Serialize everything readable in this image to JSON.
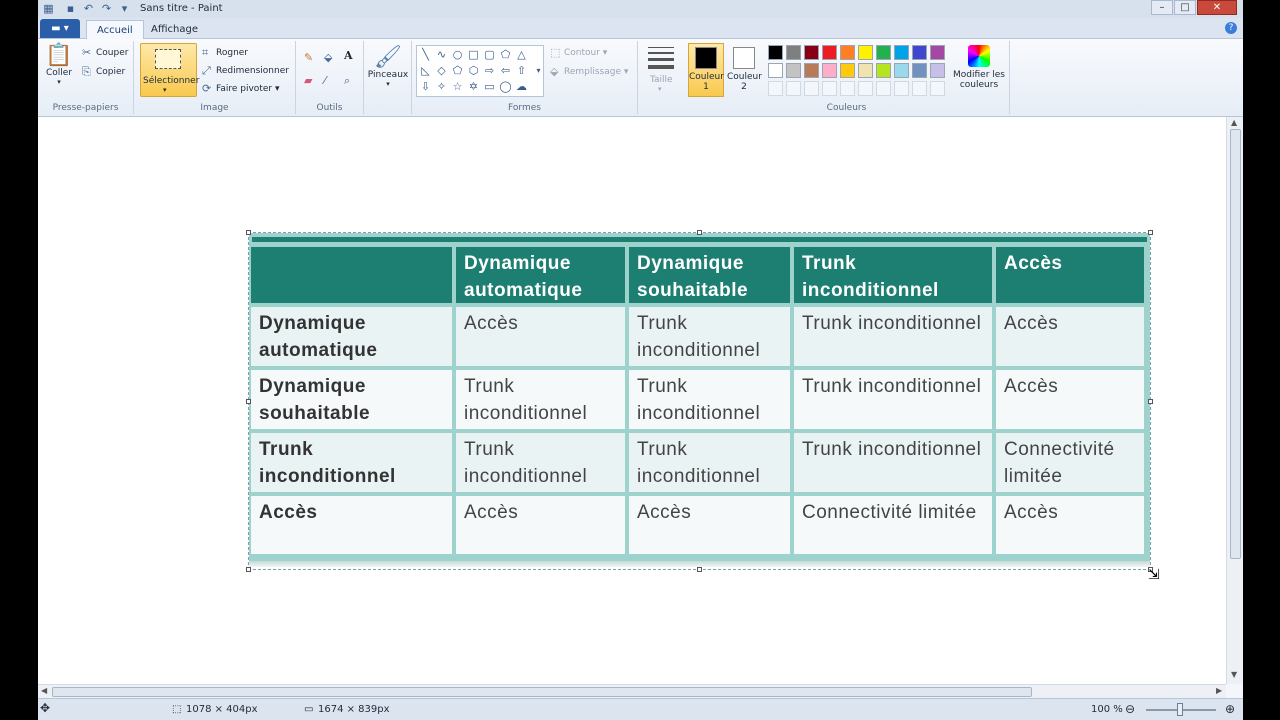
{
  "window": {
    "title": "Sans titre - Paint",
    "controls": {
      "minimize": "–",
      "maximize": "□",
      "close": "✕"
    }
  },
  "tabs": {
    "file_menu": "▾",
    "home": "Accueil",
    "view": "Affichage"
  },
  "ribbon": {
    "clipboard": {
      "label": "Presse-papiers",
      "paste": "Coller",
      "cut": "Couper",
      "copy": "Copier"
    },
    "image": {
      "label": "Image",
      "select": "Sélectionner",
      "crop": "Rogner",
      "resize": "Redimensionner",
      "rotate": "Faire pivoter"
    },
    "tools": {
      "label": "Outils"
    },
    "brushes": {
      "label": "Pinceaux"
    },
    "shapes": {
      "label": "Formes",
      "outline": "Contour",
      "fill": "Remplissage"
    },
    "size": {
      "label": "Taille"
    },
    "colors": {
      "label": "Couleurs",
      "color1": "Couleur 1",
      "color2": "Couleur 2",
      "edit": "Modifier les couleurs",
      "color1_value": "#000000",
      "color2_value": "#ffffff",
      "palette_row1": [
        "#000000",
        "#7f7f7f",
        "#880015",
        "#ed1c24",
        "#ff7f27",
        "#fff200",
        "#22b14c",
        "#00a2e8",
        "#3f48cc",
        "#a349a4"
      ],
      "palette_row2": [
        "#ffffff",
        "#c3c3c3",
        "#b97a57",
        "#ffaec9",
        "#ffc90e",
        "#efe4b0",
        "#b5e61d",
        "#99d9ea",
        "#7092be",
        "#c8bfe7"
      ]
    }
  },
  "table": {
    "headers": [
      "",
      "Dynamique automatique",
      "Dynamique souhaitable",
      "Trunk inconditionnel",
      "Accès"
    ],
    "rows": [
      [
        "Dynamique automatique",
        "Accès",
        "Trunk inconditionnel",
        "Trunk inconditionnel",
        "Accès"
      ],
      [
        "Dynamique souhaitable",
        "Trunk inconditionnel",
        "Trunk inconditionnel",
        "Trunk inconditionnel",
        "Accès"
      ],
      [
        "Trunk inconditionnel",
        "Trunk inconditionnel",
        "Trunk inconditionnel",
        "Trunk inconditionnel",
        "Connectivité limitée"
      ],
      [
        "Accès",
        "Accès",
        "Accès",
        "Connectivité limitée",
        "Accès"
      ]
    ]
  },
  "status": {
    "selection_size": "1078 × 404px",
    "image_size": "1674 × 839px",
    "zoom": "100 %",
    "zoom_out": "⊖",
    "zoom_in": "⊕"
  }
}
